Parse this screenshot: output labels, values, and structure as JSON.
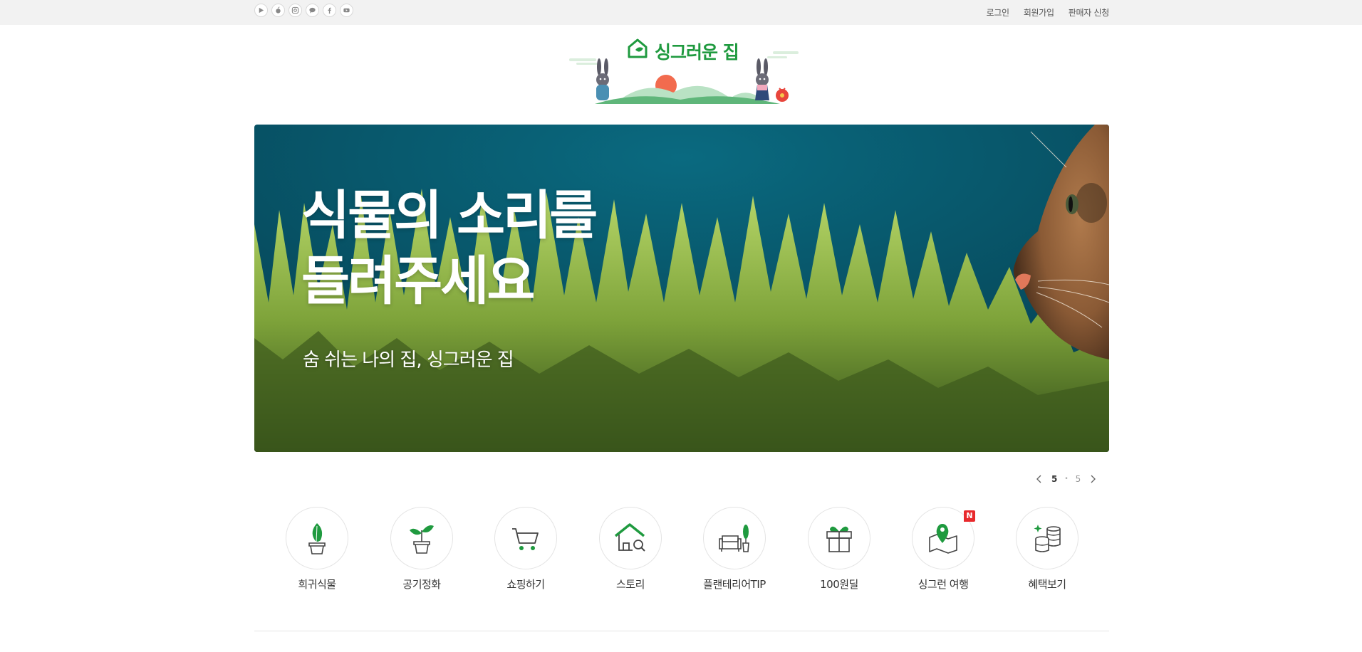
{
  "topbar": {
    "social": [
      {
        "icon": "play-store-icon"
      },
      {
        "icon": "apple-icon"
      },
      {
        "icon": "instagram-icon"
      },
      {
        "icon": "chat-icon"
      },
      {
        "icon": "facebook-icon"
      },
      {
        "icon": "youtube-icon"
      }
    ],
    "links": {
      "login": "로그인",
      "signup": "회원가입",
      "seller": "판매자 신청"
    }
  },
  "logo": {
    "text": "싱그러운 집"
  },
  "banner": {
    "title_line1": "식물의 소리를",
    "title_line2": "들려주세요",
    "subtitle": "숨 쉬는 나의 집, 싱그러운 집"
  },
  "pager": {
    "current": "5",
    "separator": "•",
    "total": "5"
  },
  "categories": [
    {
      "label": "희귀식물",
      "icon": "rare-plant-icon"
    },
    {
      "label": "공기정화",
      "icon": "sprout-pot-icon"
    },
    {
      "label": "쇼핑하기",
      "icon": "shopping-cart-icon"
    },
    {
      "label": "스토리",
      "icon": "house-search-icon"
    },
    {
      "label": "플랜테리어TIP",
      "icon": "sofa-plant-icon"
    },
    {
      "label": "100원딜",
      "icon": "gift-box-icon"
    },
    {
      "label": "싱그런 여행",
      "icon": "map-pin-icon",
      "badge": "N"
    },
    {
      "label": "혜택보기",
      "icon": "coin-stack-icon"
    }
  ],
  "colors": {
    "brand_green": "#1f9a3f",
    "badge_red": "#e8292c",
    "topbar_bg": "#f2f2f2"
  }
}
